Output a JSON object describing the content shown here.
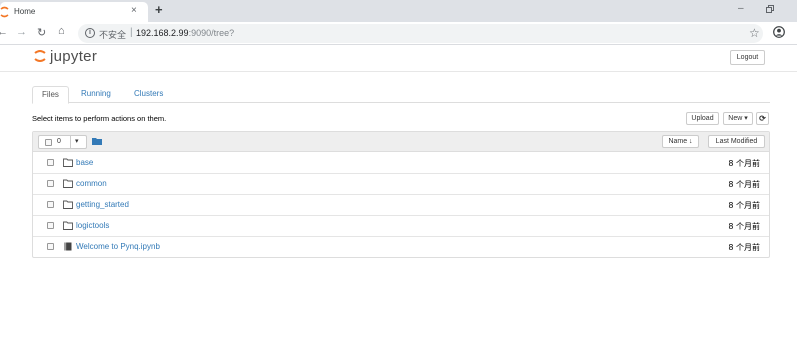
{
  "browser": {
    "tab_title": "Home",
    "tab_close": "×",
    "new_tab": "+",
    "minimize": "–",
    "url_security": "不安全",
    "url_separator": "|",
    "url_host": "192.168.2.99",
    "url_rest": ":9090/tree?"
  },
  "header": {
    "logo_text": "jupyter",
    "logout_label": "Logout"
  },
  "tabs": [
    {
      "label": "Files",
      "active": true
    },
    {
      "label": "Running",
      "active": false
    },
    {
      "label": "Clusters",
      "active": false
    }
  ],
  "toolbar": {
    "hint": "Select items to perform actions on them.",
    "upload_label": "Upload",
    "new_label": "New ▾",
    "refresh_icon": "refresh-icon"
  },
  "list_header": {
    "selected_count": "0",
    "name_label": "Name ↓",
    "last_modified_label": "Last Modified"
  },
  "files": [
    {
      "name": "base",
      "type": "folder",
      "modified": "8 个月前"
    },
    {
      "name": "common",
      "type": "folder",
      "modified": "8 个月前"
    },
    {
      "name": "getting_started",
      "type": "folder",
      "modified": "8 个月前"
    },
    {
      "name": "logictools",
      "type": "folder",
      "modified": "8 个月前"
    },
    {
      "name": "Welcome to Pynq.ipynb",
      "type": "notebook",
      "modified": "8 个月前"
    }
  ],
  "colors": {
    "link": "#337ab7",
    "jupyter_orange": "#f37726",
    "tabbar_bg": "#dee1e6"
  }
}
